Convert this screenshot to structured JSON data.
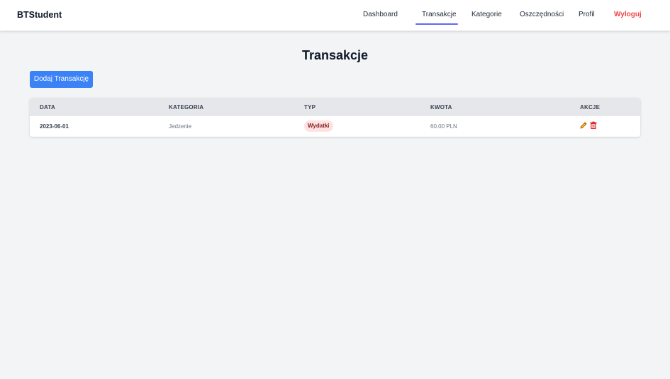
{
  "app": {
    "brand": "BTStudent"
  },
  "nav": {
    "items": [
      {
        "label": "Dashboard"
      },
      {
        "label": "Transakcje"
      },
      {
        "label": "Kategorie"
      },
      {
        "label": "Oszczędności"
      },
      {
        "label": "Profil"
      },
      {
        "label": "Wyloguj"
      }
    ],
    "active": "Transakcje"
  },
  "page": {
    "title": "Transakcje",
    "add_button_label": "Dodaj Transakcję"
  },
  "table": {
    "columns": [
      "DATA",
      "KATEGORIA",
      "TYP",
      "KWOTA",
      "AKCJE"
    ],
    "rows": [
      {
        "date": "2023-06-01",
        "category": "Jedzenie",
        "type": "Wydatki",
        "amount": "60.00 PLN",
        "actions": [
          "pencil-icon",
          "trash-icon"
        ]
      }
    ]
  },
  "colors": {
    "accent": "#3b82f6",
    "nav_active_underline": "#6366f1",
    "logout": "#ef4444",
    "expense_badge_bg": "#fee2e2",
    "edit_icon": "#eab308",
    "delete_icon": "#dc2626"
  }
}
